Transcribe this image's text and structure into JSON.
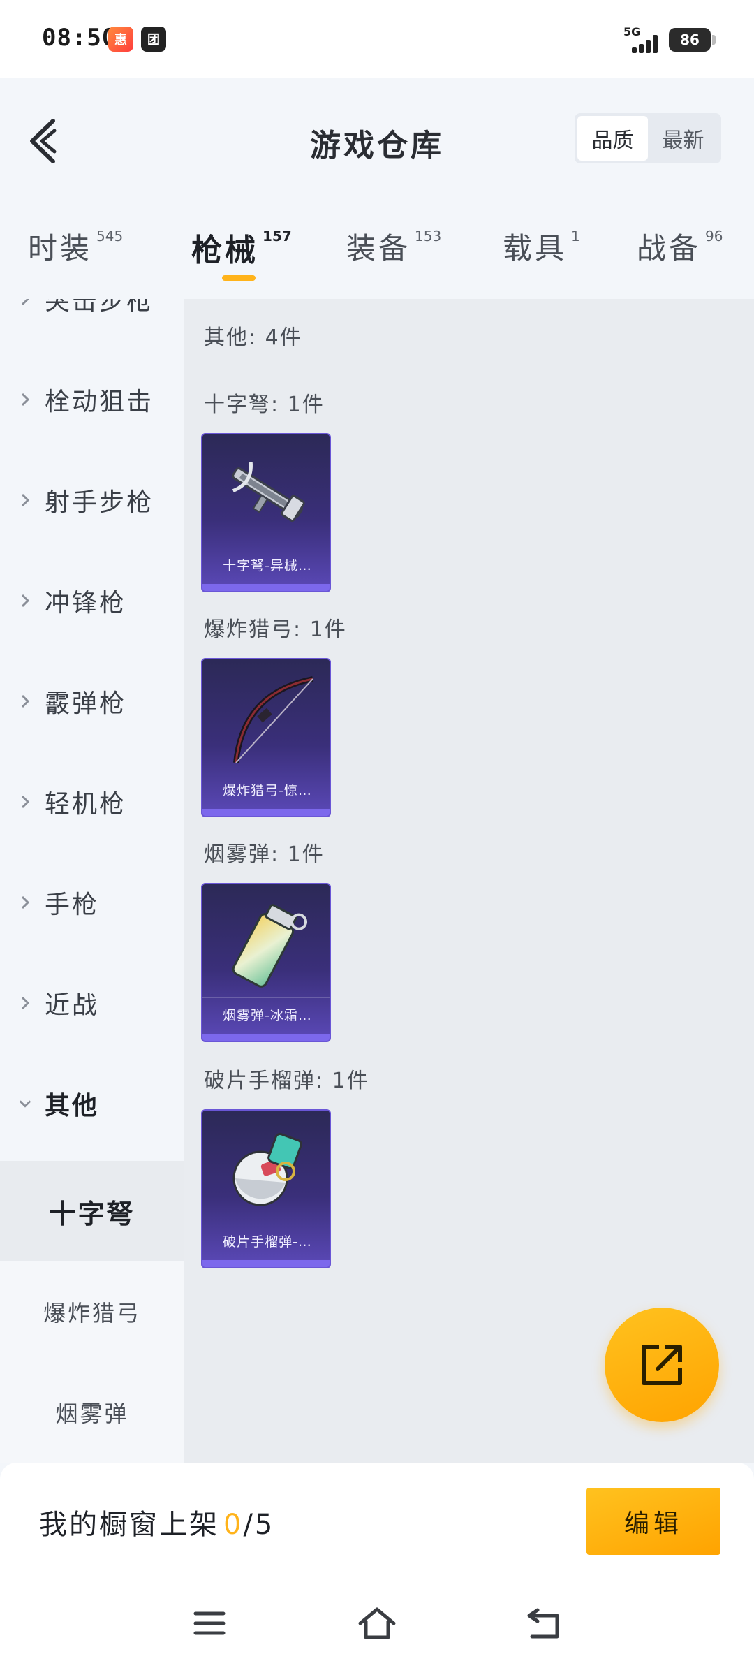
{
  "status_bar": {
    "time": "08:50",
    "app_icon_1": "惠",
    "app_icon_2": "团",
    "network": "5G",
    "battery": "86"
  },
  "header": {
    "title": "游戏仓库",
    "sort_options": [
      "品质",
      "最新"
    ],
    "active_sort": "品质"
  },
  "tabs": [
    {
      "label": "时装",
      "count": "545"
    },
    {
      "label": "枪械",
      "count": "157"
    },
    {
      "label": "装备",
      "count": "153"
    },
    {
      "label": "载具",
      "count": "1"
    },
    {
      "label": "战备",
      "count": "96"
    }
  ],
  "active_tab": "枪械",
  "sidebar": {
    "categories": [
      {
        "label": "突击步枪"
      },
      {
        "label": "栓动狙击"
      },
      {
        "label": "射手步枪"
      },
      {
        "label": "冲锋枪"
      },
      {
        "label": "霰弹枪"
      },
      {
        "label": "轻机枪"
      },
      {
        "label": "手枪"
      },
      {
        "label": "近战"
      },
      {
        "label": "其他"
      }
    ],
    "sub_items": [
      {
        "label": "十字弩"
      },
      {
        "label": "爆炸猎弓"
      },
      {
        "label": "烟雾弹"
      }
    ]
  },
  "content": {
    "summary": "其他: 4件",
    "groups": [
      {
        "title": "十字弩: 1件",
        "item_name": "十字弩-异械…",
        "icon": "crossbow-icon"
      },
      {
        "title": "爆炸猎弓: 1件",
        "item_name": "爆炸猎弓-惊…",
        "icon": "bow-icon"
      },
      {
        "title": "烟雾弹: 1件",
        "item_name": "烟雾弹-冰霜…",
        "icon": "smoke-grenade-icon"
      },
      {
        "title": "破片手榴弹: 1件",
        "item_name": "破片手榴弹-…",
        "icon": "frag-grenade-icon"
      }
    ]
  },
  "bottom_bar": {
    "showcase_label": "我的橱窗上架",
    "showcase_count": "0",
    "showcase_total": "/5",
    "edit_label": "编辑"
  },
  "colors": {
    "accent": "#ffb31a",
    "card_bg": "#3a2f7a",
    "card_border": "#6a56d6"
  }
}
